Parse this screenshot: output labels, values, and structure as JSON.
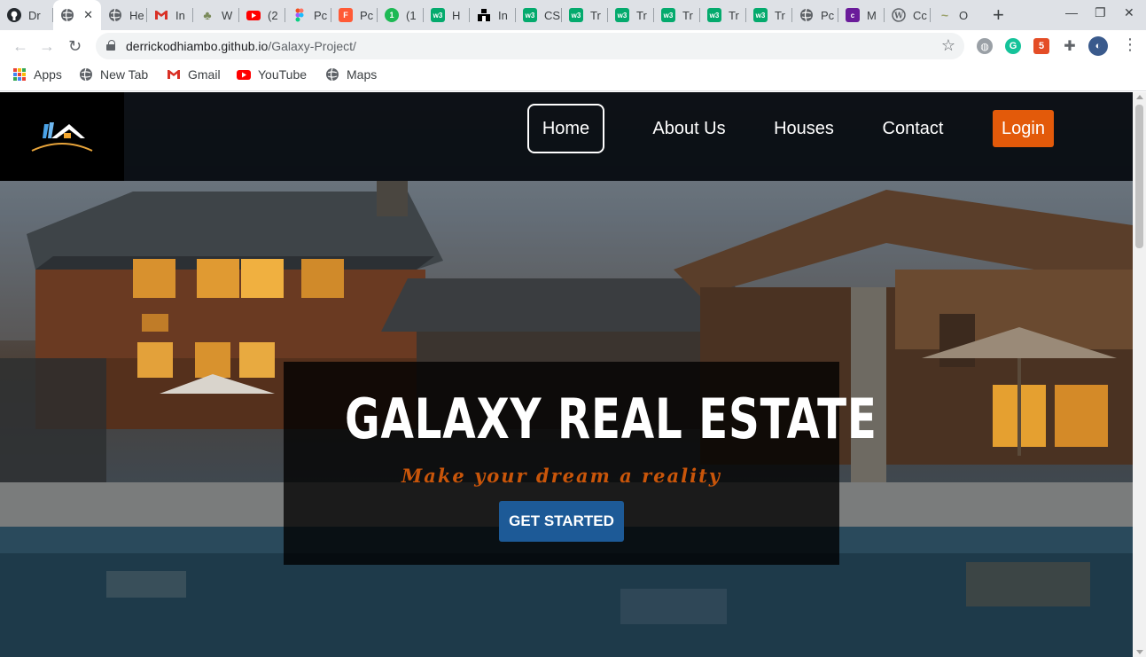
{
  "browser": {
    "tabs": [
      {
        "title": "Dr",
        "icon": "github-icon",
        "color": "#24292e",
        "glyph": "◉"
      },
      {
        "title": "",
        "icon": "globe-icon",
        "color": "#5f6368",
        "glyph": "◍",
        "active": true
      },
      {
        "title": "He",
        "icon": "globe-icon",
        "color": "#5f6368",
        "glyph": "◍"
      },
      {
        "title": "In",
        "icon": "gmail-icon",
        "color": "#ffffff",
        "glyph": "M"
      },
      {
        "title": "W",
        "icon": "palm-icon",
        "color": "#ffffff",
        "glyph": "♣"
      },
      {
        "title": "(2",
        "icon": "youtube-icon",
        "color": "#ff0000",
        "glyph": "▶"
      },
      {
        "title": "Pc",
        "icon": "figma-icon",
        "color": "#ffffff",
        "glyph": "✦"
      },
      {
        "title": "Pc",
        "icon": "f-icon",
        "color": "#ff5a36",
        "glyph": "F"
      },
      {
        "title": "(1",
        "icon": "counter-icon",
        "color": "#1db954",
        "glyph": "1"
      },
      {
        "title": "H",
        "icon": "w3schools-icon",
        "color": "#04aa6d",
        "glyph": "w3"
      },
      {
        "title": "In",
        "icon": "blocks-icon",
        "color": "#000000",
        "glyph": "▟"
      },
      {
        "title": "CS",
        "icon": "w3schools-icon",
        "color": "#04aa6d",
        "glyph": "w3"
      },
      {
        "title": "Tr",
        "icon": "w3schools-icon",
        "color": "#04aa6d",
        "glyph": "w3"
      },
      {
        "title": "Tr",
        "icon": "w3schools-icon",
        "color": "#04aa6d",
        "glyph": "w3"
      },
      {
        "title": "Tr",
        "icon": "w3schools-icon",
        "color": "#04aa6d",
        "glyph": "w3"
      },
      {
        "title": "Tr",
        "icon": "w3schools-icon",
        "color": "#04aa6d",
        "glyph": "w3"
      },
      {
        "title": "Tr",
        "icon": "w3schools-icon",
        "color": "#04aa6d",
        "glyph": "w3"
      },
      {
        "title": "Pc",
        "icon": "globe-icon",
        "color": "#5f6368",
        "glyph": "◍"
      },
      {
        "title": "M",
        "icon": "colorlib-icon",
        "color": "#6a1b9a",
        "glyph": "c"
      },
      {
        "title": "Cc",
        "icon": "wordpress-icon",
        "color": "#5f6368",
        "glyph": "W"
      },
      {
        "title": "O",
        "icon": "bird-icon",
        "color": "#9aa06b",
        "glyph": "~"
      }
    ],
    "url_domain": "derrickodhiambo.github.io",
    "url_path": "/Galaxy-Project/",
    "bookmarks": [
      {
        "label": "Apps",
        "icon": "apps-icon"
      },
      {
        "label": "New Tab",
        "icon": "globe-icon"
      },
      {
        "label": "Gmail",
        "icon": "gmail-icon"
      },
      {
        "label": "YouTube",
        "icon": "youtube-icon"
      },
      {
        "label": "Maps",
        "icon": "globe-icon"
      }
    ]
  },
  "site": {
    "nav": [
      {
        "label": "Home",
        "active": true
      },
      {
        "label": "About Us"
      },
      {
        "label": "Houses"
      },
      {
        "label": "Contact"
      }
    ],
    "login_label": "Login",
    "hero_title": "GALAXY REAL ESTATE",
    "hero_tagline": "Make your dream a reality",
    "cta_label": "GET STARTED",
    "colors": {
      "header_bg": "#080c12",
      "login_bg": "#e35a0a",
      "tagline": "#c8550a",
      "cta_bg": "#1d5a97"
    }
  }
}
